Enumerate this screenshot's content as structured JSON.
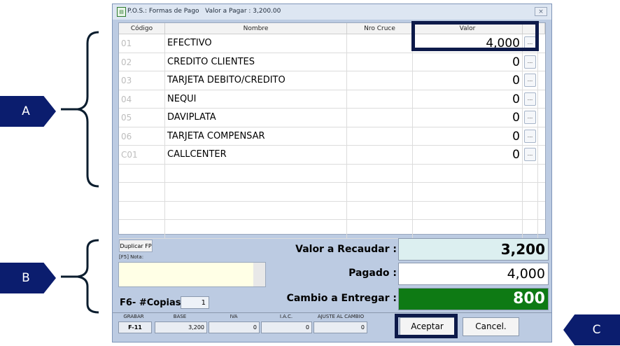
{
  "window": {
    "title": "P.O.S.: Formas de Pago",
    "subtitle": "Valor a Pagar : 3,200.00",
    "close": "×"
  },
  "grid": {
    "headers": {
      "code": "Código",
      "name": "Nombre",
      "cruce": "Nro Cruce",
      "valor": "Valor"
    },
    "rows": [
      {
        "code": "01",
        "name": "EFECTIVO",
        "value": "4,000"
      },
      {
        "code": "02",
        "name": "CREDITO CLIENTES",
        "value": "0"
      },
      {
        "code": "03",
        "name": "TARJETA DEBITO/CREDITO",
        "value": "0"
      },
      {
        "code": "04",
        "name": "NEQUI",
        "value": "0"
      },
      {
        "code": "05",
        "name": "DAVIPLATA",
        "value": "0"
      },
      {
        "code": "06",
        "name": "TARJETA COMPENSAR",
        "value": "0"
      },
      {
        "code": "C01",
        "name": "CALLCENTER",
        "value": "0"
      }
    ],
    "row_button": "..."
  },
  "bottom": {
    "duplicar": "Duplicar FP",
    "nota_label": "[F5] Nota:",
    "copias_label": "F6- #Copias",
    "copias_value": "1",
    "recaudar_label": "Valor a Recaudar :",
    "recaudar_value": "3,200",
    "pagado_label": "Pagado  :",
    "pagado_value": "4,000",
    "cambio_label": "Cambio a Entregar :",
    "cambio_value": "800"
  },
  "totals": {
    "grabar_label": "GRABAR",
    "grabar_value": "F-11",
    "base_label": "BASE",
    "base_value": "3,200",
    "iva_label": "IVA",
    "iva_value": "0",
    "iac_label": "I.A.C.",
    "iac_value": "0",
    "ajuste_label": "AJUSTE AL CAMBIO",
    "ajuste_value": "0"
  },
  "buttons": {
    "accept": "Aceptar",
    "cancel": "Cancel."
  },
  "annotations": {
    "a": "A",
    "b": "B",
    "c": "C"
  },
  "colors": {
    "accent": "#0b1d6e",
    "cambio_bg": "#0e7a14",
    "recaudar_bg": "#dceff0"
  }
}
